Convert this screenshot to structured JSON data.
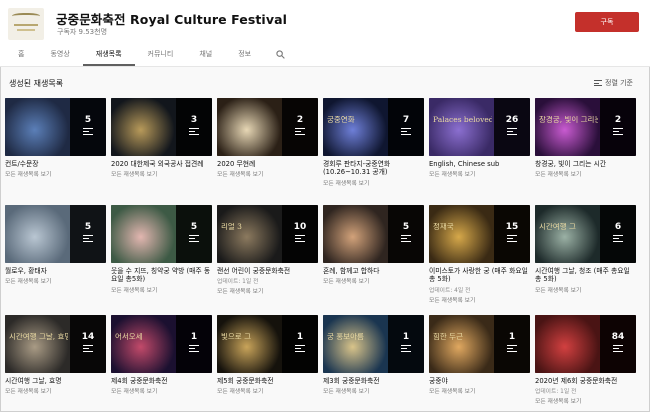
{
  "channel": {
    "name": "궁중문화축전 Royal Culture Festival",
    "subscribers": "구독자 9.53천명",
    "subscribe_label": "구독",
    "logo_icon": "palace-roof-logo"
  },
  "tabs": [
    {
      "label": "홈",
      "active": false
    },
    {
      "label": "동영상",
      "active": false
    },
    {
      "label": "재생목록",
      "active": true
    },
    {
      "label": "커뮤니티",
      "active": false
    },
    {
      "label": "채널",
      "active": false
    },
    {
      "label": "정보",
      "active": false
    }
  ],
  "search_icon": "search-icon",
  "section": {
    "title": "생성된 재생목록",
    "sort_label": "정렬 기준"
  },
  "playlists": [
    {
      "title": "컨트/수문장",
      "count": "5",
      "meta": "",
      "link": "모든 재생목록 보기",
      "bg": "#1f2a44",
      "accent": "#5b7fb8",
      "caption": ""
    },
    {
      "title": "2020 대한제국 외국공사 접견례",
      "count": "3",
      "meta": "",
      "link": "모든 재생목록 보기",
      "bg": "#12161c",
      "accent": "#b89a5a",
      "caption": ""
    },
    {
      "title": "2020 무현례",
      "count": "2",
      "meta": "",
      "link": "모든 재생목록 보기",
      "bg": "#2b2016",
      "accent": "#e7d7b5",
      "caption": ""
    },
    {
      "title": "경회루 판타지-궁중연화 (10.26~10.31 공개)",
      "count": "7",
      "meta": "",
      "link": "모든 재생목록 보기",
      "bg": "#0f1630",
      "accent": "#6e7fd8",
      "caption": "궁중연화"
    },
    {
      "title": "English, Chinese sub",
      "count": "26",
      "meta": "",
      "link": "모든 재생목록 보기",
      "bg": "#3a2a66",
      "accent": "#8b6fd0",
      "caption": "Palaces beloved by artists"
    },
    {
      "title": "창경궁, 빛이 그리는 시간",
      "count": "2",
      "meta": "",
      "link": "모든 재생목록 보기",
      "bg": "#2a0f3a",
      "accent": "#c95bd1",
      "caption": "창경궁, 빛이 그리는 시간"
    },
    {
      "title": "월로우, 황태자",
      "count": "5",
      "meta": "",
      "link": "모든 재생목록 보기",
      "bg": "#5a6a7a",
      "accent": "#b9c6d2",
      "caption": ""
    },
    {
      "title": "웃을 수 지뜨, 칭약궁 약방 (매주 동요일 총5화)",
      "count": "5",
      "meta": "",
      "link": "모든 재생목록 보기",
      "bg": "#3d5a45",
      "accent": "#e2b6b0",
      "caption": ""
    },
    {
      "title": "랜선 어린이 궁중문화축전",
      "count": "10",
      "meta": "업데이트: 1일 전",
      "link": "모든 재생목록 보기",
      "bg": "#1a1a1a",
      "accent": "#8c7a5f",
      "caption": "리얼 3"
    },
    {
      "title": "혼례, 함께고 합하다",
      "count": "5",
      "meta": "",
      "link": "모든 재생목록 보기",
      "bg": "#2f2520",
      "accent": "#d2a27a",
      "caption": ""
    },
    {
      "title": "이미스토가 사랑한 궁 (매주 화요일 총 5화)",
      "count": "15",
      "meta": "업데이트: 4일 전",
      "link": "모든 재생목록 보기",
      "bg": "#3a2a14",
      "accent": "#d6a84a",
      "caption": "정재국"
    },
    {
      "title": "시간여행 그날, 청조 (매주 총요일 총 5화)",
      "count": "6",
      "meta": "",
      "link": "모든 재생목록 보기",
      "bg": "#1d2a2a",
      "accent": "#9bb1a5",
      "caption": "시간여행 그"
    },
    {
      "title": "시간여행 그날, 효명",
      "count": "14",
      "meta": "",
      "link": "모든 재생목록 보기",
      "bg": "#2c2a28",
      "accent": "#a99b85",
      "caption": "시간여행 그날, 효명"
    },
    {
      "title": "제4회 궁중문화축전",
      "count": "1",
      "meta": "",
      "link": "모든 재생목록 보기",
      "bg": "#1b1030",
      "accent": "#c24a6a",
      "caption": "어서오세"
    },
    {
      "title": "제5회 궁중문화축전",
      "count": "1",
      "meta": "",
      "link": "모든 재생목록 보기",
      "bg": "#15120c",
      "accent": "#c9a45a",
      "caption": "빛으로 그"
    },
    {
      "title": "제3회 궁중문화축전",
      "count": "1",
      "meta": "",
      "link": "모든 재생목록 보기",
      "bg": "#1a3550",
      "accent": "#d9c48a",
      "caption": "궁 홍보아름"
    },
    {
      "title": "궁중야",
      "count": "1",
      "meta": "",
      "link": "모든 재생목록 보기",
      "bg": "#3a2a18",
      "accent": "#e0a860",
      "caption": "힘한 두근"
    },
    {
      "title": "2020년 제6회 궁중문화축전",
      "count": "84",
      "meta": "업데이트: 1일 전",
      "link": "모든 재생목록 보기",
      "bg": "#4a1414",
      "accent": "#d24040",
      "caption": ""
    }
  ],
  "colors": {
    "subscribe": "#c4302b",
    "active_tab_underline": "#606060"
  }
}
